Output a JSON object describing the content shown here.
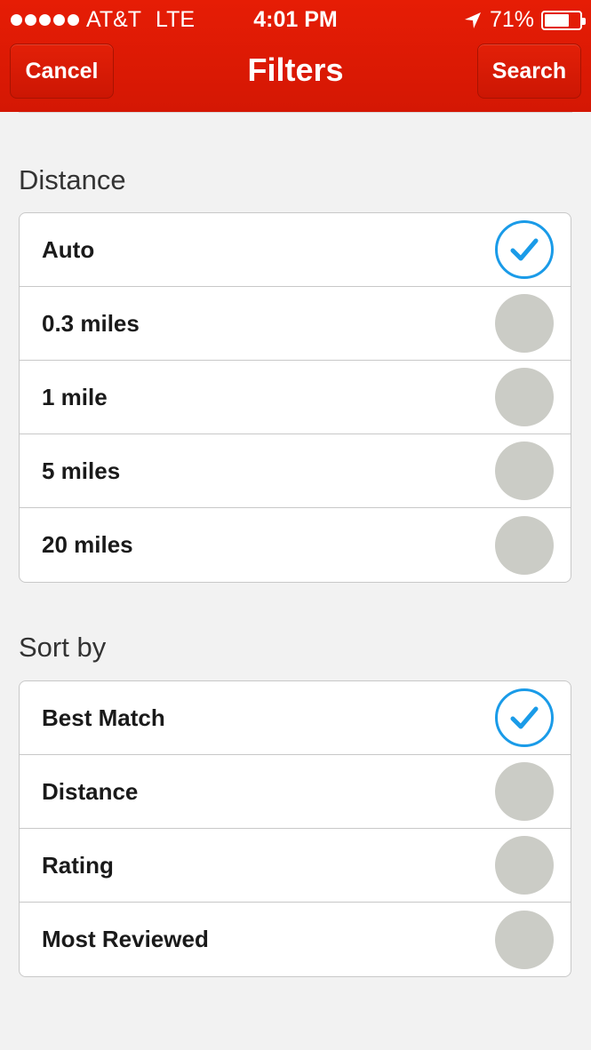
{
  "status_bar": {
    "carrier": "AT&T",
    "network": "LTE",
    "time": "4:01 PM",
    "battery": "71%",
    "battery_level": 0.71
  },
  "nav": {
    "cancel_label": "Cancel",
    "title": "Filters",
    "search_label": "Search"
  },
  "distance": {
    "header": "Distance",
    "options": [
      {
        "label": "Auto",
        "selected": true
      },
      {
        "label": "0.3 miles",
        "selected": false
      },
      {
        "label": "1 mile",
        "selected": false
      },
      {
        "label": "5 miles",
        "selected": false
      },
      {
        "label": "20 miles",
        "selected": false
      }
    ]
  },
  "sort": {
    "header": "Sort by",
    "options": [
      {
        "label": "Best Match",
        "selected": true
      },
      {
        "label": "Distance",
        "selected": false
      },
      {
        "label": "Rating",
        "selected": false
      },
      {
        "label": "Most Reviewed",
        "selected": false
      }
    ]
  },
  "colors": {
    "brand_red": "#d41704",
    "check_blue": "#1a9be8",
    "unselected_gray": "#cbccc6"
  }
}
